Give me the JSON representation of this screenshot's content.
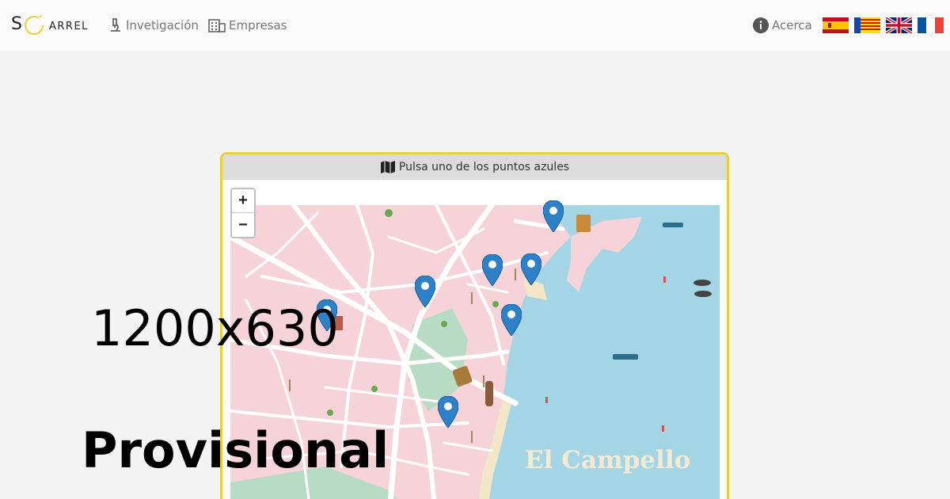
{
  "header": {
    "logo": {
      "s": "S",
      "arrel": "ARREL"
    },
    "nav": {
      "investigacion": "Invetigación",
      "empresas": "Empresas",
      "acerca": "Acerca"
    },
    "flags": [
      "es-flag-icon",
      "valencian-flag-icon",
      "uk-flag-icon",
      "fr-flag-icon"
    ]
  },
  "map_card": {
    "instruction": "Pulsa uno de los puntos azules",
    "zoom_in": "+",
    "zoom_out": "−",
    "map_label": "El Campello",
    "marker_count": 7,
    "colors": {
      "border": "#e8cf3c",
      "land": "#f6d3d8",
      "sea": "#a4d5e5",
      "park": "#b8dbc3",
      "marker": "#2c81c8"
    }
  },
  "overlay": {
    "size_text": "1200x630",
    "provisional_text": "Provisional"
  }
}
